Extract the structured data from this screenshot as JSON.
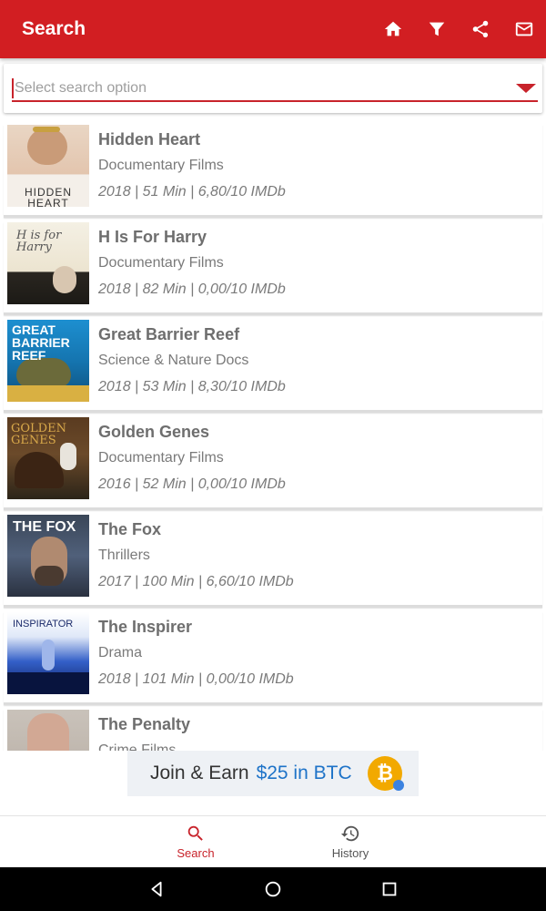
{
  "appbar": {
    "title": "Search",
    "actions": [
      "home-icon",
      "filter-icon",
      "share-icon",
      "mail-icon"
    ]
  },
  "search": {
    "placeholder": "Select search option"
  },
  "results": [
    {
      "title": "Hidden Heart",
      "genre": "Documentary Films",
      "meta": "2018 | 51 Min | 6,80/10 IMDb",
      "poster_text": "HIDDEN HEART"
    },
    {
      "title": "H Is For Harry",
      "genre": "Documentary Films",
      "meta": "2018 | 82 Min | 0,00/10 IMDb",
      "poster_text": "H is for Harry"
    },
    {
      "title": "Great Barrier Reef",
      "genre": "Science & Nature Docs",
      "meta": "2018 | 53 Min | 8,30/10 IMDb",
      "poster_text": "GREAT BARRIER REEF"
    },
    {
      "title": "Golden Genes",
      "genre": "Documentary Films",
      "meta": "2016 | 52 Min | 0,00/10 IMDb",
      "poster_text": "GOLDEN GENES"
    },
    {
      "title": "The Fox",
      "genre": "Thrillers",
      "meta": "2017 | 100 Min | 6,60/10 IMDb",
      "poster_text": "THE FOX"
    },
    {
      "title": "The Inspirer",
      "genre": "Drama",
      "meta": "2018 | 101 Min | 0,00/10 IMDb",
      "poster_text": "INSPIRATOR"
    },
    {
      "title": "The Penalty",
      "genre": "Crime Films",
      "meta": "",
      "poster_text": ""
    }
  ],
  "banner": {
    "text": "Join & Earn",
    "amount": "$25 in BTC",
    "coin_symbol": "₿"
  },
  "bottom_nav": {
    "search_label": "Search",
    "history_label": "History"
  },
  "colors": {
    "primary": "#d21e22",
    "accent": "#c8232b"
  }
}
